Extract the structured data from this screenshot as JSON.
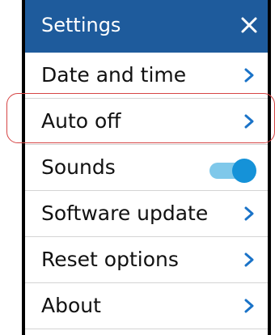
{
  "header": {
    "title": "Settings",
    "close_icon": "close-icon"
  },
  "menu": [
    {
      "label": "Date and time",
      "control": "chevron-right-icon"
    },
    {
      "label": "Auto off",
      "control": "chevron-right-icon",
      "highlighted": true
    },
    {
      "label": "Sounds",
      "control": "toggle",
      "toggle_on": true
    },
    {
      "label": "Software update",
      "control": "chevron-right-icon"
    },
    {
      "label": "Reset options",
      "control": "chevron-right-icon"
    },
    {
      "label": "About",
      "control": "chevron-right-icon"
    }
  ],
  "colors": {
    "header_bg": "#1e5b9c",
    "chevron": "#1a73c8",
    "toggle_track": "#7fc8ea",
    "toggle_knob": "#1592d8",
    "highlight": "#d64545"
  }
}
